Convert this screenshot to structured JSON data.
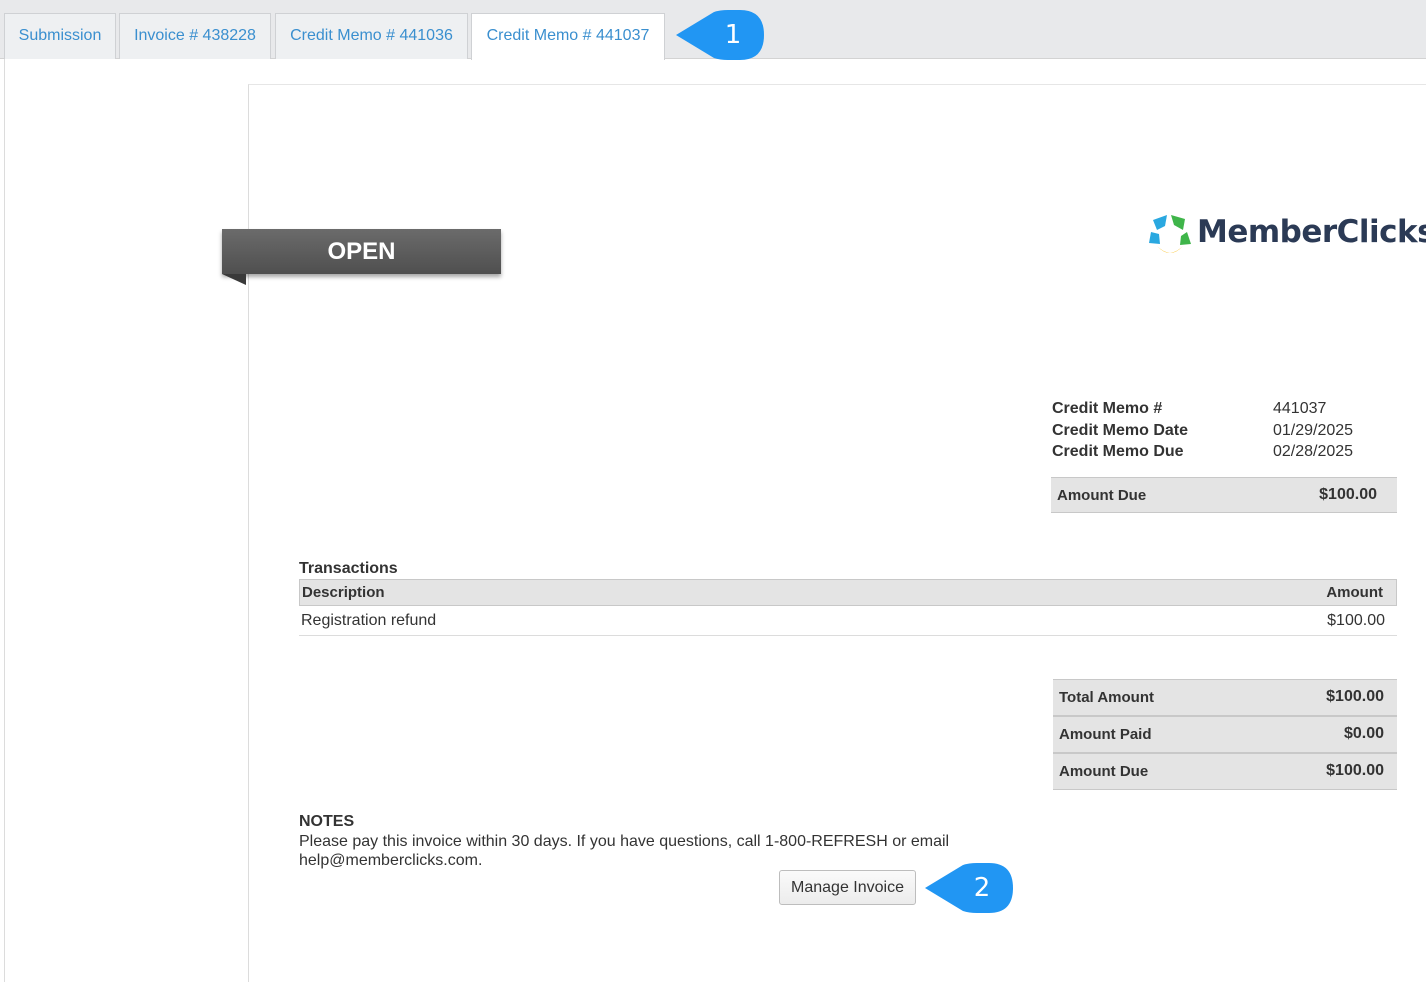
{
  "tabs": [
    {
      "label": "Submission",
      "active": false
    },
    {
      "label": "Invoice # 438228",
      "active": false
    },
    {
      "label": "Credit Memo # 441036",
      "active": false
    },
    {
      "label": "Credit Memo # 441037",
      "active": true
    }
  ],
  "callouts": [
    "1",
    "2"
  ],
  "status_ribbon": "OPEN",
  "logo": {
    "text": "MemberClicks",
    "icon": "memberclicks-logo-icon"
  },
  "meta": [
    {
      "label": "Credit Memo #",
      "value": "441037"
    },
    {
      "label": "Credit Memo Date",
      "value": "01/29/2025"
    },
    {
      "label": "Credit Memo Due",
      "value": "02/28/2025"
    }
  ],
  "amount_due_box": {
    "label": "Amount Due",
    "value": "$100.00"
  },
  "transactions": {
    "title": "Transactions",
    "headers": {
      "description": "Description",
      "amount": "Amount"
    },
    "rows": [
      {
        "description": "Registration refund",
        "amount": "$100.00"
      }
    ]
  },
  "totals": [
    {
      "label": "Total Amount",
      "value": "$100.00"
    },
    {
      "label": "Amount Paid",
      "value": "$0.00"
    },
    {
      "label": "Amount Due",
      "value": "$100.00"
    }
  ],
  "notes": {
    "title": "NOTES",
    "text": "Please pay this invoice within 30 days. If you have questions, call 1-800-REFRESH or email help@memberclicks.com."
  },
  "manage_button": "Manage Invoice",
  "colors": {
    "tab_text": "#3a8fcf",
    "callout": "#2196f3",
    "ribbon": "#5a5a5a"
  }
}
